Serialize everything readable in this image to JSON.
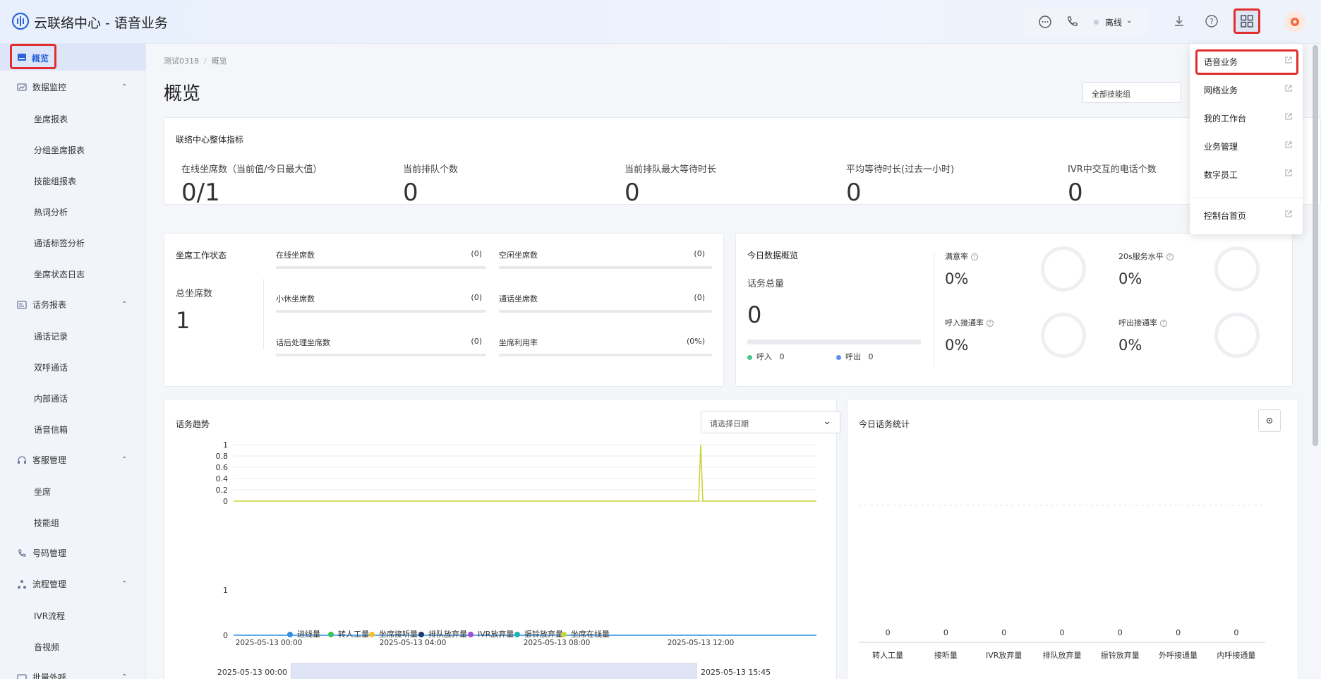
{
  "app": {
    "title": "云联络中心 - 语音业务"
  },
  "header": {
    "status_label": "离线",
    "icons": [
      "chat-icon",
      "phone-icon",
      "download-icon",
      "help-icon",
      "apps-grid-icon"
    ]
  },
  "sidebar": {
    "active": "概览",
    "groups": [
      {
        "label": "数据监控",
        "items": [
          "坐席报表",
          "分组坐席报表",
          "技能组报表",
          "热词分析",
          "通话标签分析",
          "坐席状态日志"
        ]
      },
      {
        "label": "话务报表",
        "items": [
          "通话记录",
          "双呼通话",
          "内部通话",
          "语音信箱"
        ]
      },
      {
        "label": "客服管理",
        "items": [
          "坐席",
          "技能组"
        ]
      },
      {
        "label": "号码管理",
        "items": []
      },
      {
        "label": "流程管理",
        "items": [
          "IVR流程",
          "音视频"
        ]
      },
      {
        "label": "批量外呼",
        "items": []
      }
    ]
  },
  "breadcrumb": [
    "测试0318",
    "概览"
  ],
  "page_title": "概览",
  "skill_group_select": "全部技能组",
  "overall": {
    "title": "联络中心整体指标",
    "kpis": [
      {
        "label": "在线坐席数（当前值/今日最大值）",
        "value": "0/1"
      },
      {
        "label": "当前排队个数",
        "value": "0"
      },
      {
        "label": "当前排队最大等待时长",
        "value": "0"
      },
      {
        "label": "平均等待时长(过去一小时)",
        "value": "0"
      },
      {
        "label": "IVR中交互的电话个数",
        "value": "0"
      }
    ]
  },
  "agent_status": {
    "title": "坐席工作状态",
    "total_label": "总坐席数",
    "total_value": "1",
    "items": [
      {
        "label": "在线坐席数",
        "count": "(0)"
      },
      {
        "label": "空闲坐席数",
        "count": "(0)"
      },
      {
        "label": "小休坐席数",
        "count": "(0)"
      },
      {
        "label": "通话坐席数",
        "count": "(0)"
      },
      {
        "label": "话后处理坐席数",
        "count": "(0)"
      },
      {
        "label": "坐席利用率",
        "count": "(0%)"
      }
    ]
  },
  "today_overview": {
    "title": "今日数据概览",
    "total_label": "话务总量",
    "total_value": "0",
    "inbound_label": "呼入",
    "inbound_value": "0",
    "outbound_label": "呼出",
    "outbound_value": "0",
    "rates": [
      {
        "label": "满意率",
        "value": "0%"
      },
      {
        "label": "20s服务水平",
        "value": "0%"
      },
      {
        "label": "呼入接通率",
        "value": "0%"
      },
      {
        "label": "呼出接通率",
        "value": "0%"
      }
    ]
  },
  "trend": {
    "title": "话务趋势",
    "date_placeholder": "请选择日期",
    "slider_start": "2025-05-13 00:00",
    "slider_end": "2025-05-13 15:45"
  },
  "stats": {
    "title": "今日话务统计"
  },
  "dropdown": {
    "items": [
      "语音业务",
      "网络业务",
      "我的工作台",
      "业务管理",
      "数字员工"
    ],
    "footer": "控制台首页"
  },
  "colors": {
    "accent": "#3d6fe0",
    "highlight": "#e02d2d",
    "inbound": "#4cc58f",
    "outbound": "#5b8ff9"
  },
  "chart_data": [
    {
      "type": "line",
      "title": "话务趋势",
      "x": [
        "2025-05-13 00:00",
        "2025-05-13 04:00",
        "2025-05-13 08:00",
        "2025-05-13 12:00"
      ],
      "top_panel": {
        "yticks": [
          "1",
          "0.8",
          "0.6",
          "0.4",
          "0.2",
          "0"
        ],
        "ylim": [
          0,
          1
        ],
        "series": [
          {
            "name": "坐席在线量",
            "color": "#c9d63a",
            "spike_at": "2025-05-13 12:00",
            "spike_value": 1
          }
        ]
      },
      "bottom_panel": {
        "yticks": [
          "1",
          "0"
        ],
        "ylim": [
          0,
          1
        ],
        "series": [
          {
            "name": "进线量",
            "color": "#2f8ee0",
            "value": 0
          }
        ]
      },
      "legend": [
        {
          "name": "进线量",
          "color": "#2f8ee0"
        },
        {
          "name": "转人工量",
          "color": "#35c45a"
        },
        {
          "name": "坐席接听量",
          "color": "#f2c12e"
        },
        {
          "name": "排队放弃量",
          "color": "#1f3a6e"
        },
        {
          "name": "IVR放弃量",
          "color": "#9b4fd8"
        },
        {
          "name": "振铃放弃量",
          "color": "#17b5b5"
        },
        {
          "name": "坐席在线量",
          "color": "#c9d63a"
        }
      ]
    },
    {
      "type": "bar",
      "title": "今日话务统计",
      "categories": [
        "转人工量",
        "接听量",
        "IVR放弃量",
        "排队放弃量",
        "振铃放弃量",
        "外呼接通量",
        "内呼接通量"
      ],
      "values": [
        0,
        0,
        0,
        0,
        0,
        0,
        0
      ]
    }
  ]
}
